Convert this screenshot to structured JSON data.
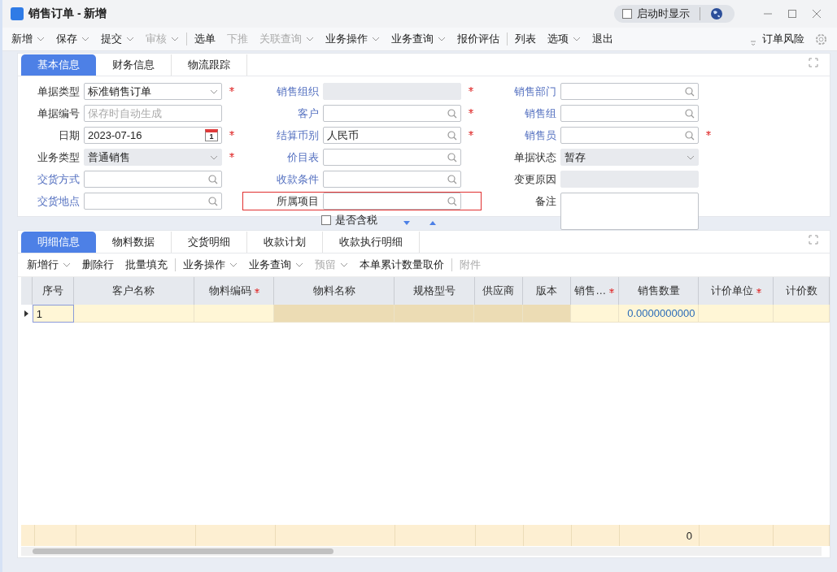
{
  "window": {
    "title": "销售订单 - 新增",
    "startup": {
      "label": "启动时显示",
      "checked": false
    }
  },
  "toolbar": {
    "items": [
      {
        "kind": "button",
        "label": "新增",
        "dropdown": true,
        "disabled": false
      },
      {
        "kind": "button",
        "label": "保存",
        "dropdown": true,
        "disabled": false
      },
      {
        "kind": "button",
        "label": "提交",
        "dropdown": true,
        "disabled": false
      },
      {
        "kind": "button",
        "label": "审核",
        "dropdown": true,
        "disabled": true
      },
      {
        "kind": "separator"
      },
      {
        "kind": "button",
        "label": "选单",
        "dropdown": false,
        "disabled": false
      },
      {
        "kind": "button",
        "label": "下推",
        "dropdown": false,
        "disabled": true
      },
      {
        "kind": "button",
        "label": "关联查询",
        "dropdown": true,
        "disabled": true
      },
      {
        "kind": "button",
        "label": "业务操作",
        "dropdown": true,
        "disabled": false
      },
      {
        "kind": "button",
        "label": "业务查询",
        "dropdown": true,
        "disabled": false
      },
      {
        "kind": "button",
        "label": "报价评估",
        "dropdown": false,
        "disabled": false
      },
      {
        "kind": "separator"
      },
      {
        "kind": "button",
        "label": "列表",
        "dropdown": false,
        "disabled": false
      },
      {
        "kind": "button",
        "label": "选项",
        "dropdown": true,
        "disabled": false
      },
      {
        "kind": "button",
        "label": "退出",
        "dropdown": false,
        "disabled": false
      }
    ],
    "right_label": "订单风险"
  },
  "header_tabs": [
    {
      "label": "基本信息",
      "selected": true
    },
    {
      "label": "财务信息",
      "selected": false
    },
    {
      "label": "物流跟踪",
      "selected": false
    }
  ],
  "form": {
    "columns": [
      {
        "fields": [
          {
            "kind": "select",
            "label": "单据类型",
            "value": "标准销售订单",
            "link": false,
            "required": true,
            "disabled": false,
            "highlighted": false
          },
          {
            "kind": "text",
            "label": "单据编号",
            "placeholder": "保存时自动生成",
            "link": false,
            "required": false,
            "disabled": false,
            "highlighted": false
          },
          {
            "kind": "date",
            "label": "日期",
            "value": "2023-07-16",
            "calendar_day": "1",
            "link": false,
            "required": true,
            "disabled": false,
            "highlighted": false
          },
          {
            "kind": "select",
            "label": "业务类型",
            "value": "普通销售",
            "link": false,
            "required": true,
            "disabled": true,
            "highlighted": false
          },
          {
            "kind": "lookup",
            "label": "交货方式",
            "link": true,
            "required": false,
            "disabled": false,
            "highlighted": false
          },
          {
            "kind": "lookup",
            "label": "交货地点",
            "link": true,
            "required": false,
            "disabled": false,
            "highlighted": false
          }
        ]
      },
      {
        "fields": [
          {
            "kind": "text",
            "label": "销售组织",
            "link": true,
            "required": true,
            "disabled": true,
            "highlighted": false
          },
          {
            "kind": "lookup",
            "label": "客户",
            "link": true,
            "required": true,
            "disabled": false,
            "highlighted": false
          },
          {
            "kind": "lookup",
            "label": "结算币别",
            "value": "人民币",
            "link": true,
            "required": true,
            "disabled": false,
            "highlighted": false
          },
          {
            "kind": "lookup",
            "label": "价目表",
            "link": true,
            "required": false,
            "disabled": false,
            "highlighted": false
          },
          {
            "kind": "lookup",
            "label": "收款条件",
            "link": true,
            "required": false,
            "disabled": false,
            "highlighted": false
          },
          {
            "kind": "lookup",
            "label": "所属项目",
            "link": false,
            "required": false,
            "disabled": false,
            "highlighted": true
          },
          {
            "kind": "checkbox",
            "label": "是否含税",
            "checked": false
          }
        ]
      },
      {
        "fields": [
          {
            "kind": "lookup",
            "label": "销售部门",
            "link": true,
            "required": false,
            "disabled": false,
            "highlighted": false
          },
          {
            "kind": "lookup",
            "label": "销售组",
            "link": true,
            "required": false,
            "disabled": false,
            "highlighted": false
          },
          {
            "kind": "lookup",
            "label": "销售员",
            "link": true,
            "required": true,
            "disabled": false,
            "highlighted": false
          },
          {
            "kind": "select",
            "label": "单据状态",
            "value": "暂存",
            "link": false,
            "required": false,
            "disabled": true,
            "highlighted": false
          },
          {
            "kind": "text",
            "label": "变更原因",
            "link": false,
            "required": false,
            "disabled": true,
            "highlighted": false
          },
          {
            "kind": "textarea",
            "label": "备注",
            "link": false,
            "required": false,
            "disabled": false,
            "highlighted": false
          }
        ]
      }
    ]
  },
  "detail_tabs": [
    {
      "label": "明细信息",
      "selected": true
    },
    {
      "label": "物料数据",
      "selected": false
    },
    {
      "label": "交货明细",
      "selected": false
    },
    {
      "label": "收款计划",
      "selected": false
    },
    {
      "label": "收款执行明细",
      "selected": false
    }
  ],
  "detail_toolbar": [
    {
      "kind": "button",
      "label": "新增行",
      "dropdown": true,
      "disabled": false
    },
    {
      "kind": "button",
      "label": "删除行",
      "dropdown": false,
      "disabled": false
    },
    {
      "kind": "button",
      "label": "批量填充",
      "dropdown": false,
      "disabled": false
    },
    {
      "kind": "separator"
    },
    {
      "kind": "button",
      "label": "业务操作",
      "dropdown": true,
      "disabled": false
    },
    {
      "kind": "button",
      "label": "业务查询",
      "dropdown": true,
      "disabled": false
    },
    {
      "kind": "button",
      "label": "预留",
      "dropdown": true,
      "disabled": true
    },
    {
      "kind": "button",
      "label": "本单累计数量取价",
      "dropdown": false,
      "disabled": false
    },
    {
      "kind": "separator"
    },
    {
      "kind": "button",
      "label": "附件",
      "dropdown": false,
      "disabled": true
    }
  ],
  "table": {
    "columns": [
      {
        "kind": "seq",
        "label": "序号",
        "required": false,
        "locked": false
      },
      {
        "kind": "text",
        "label": "客户名称",
        "required": false,
        "locked": false
      },
      {
        "kind": "text",
        "label": "物料编码",
        "required": true,
        "locked": false
      },
      {
        "kind": "text",
        "label": "物料名称",
        "required": false,
        "locked": true
      },
      {
        "kind": "text",
        "label": "规格型号",
        "required": false,
        "locked": true
      },
      {
        "kind": "text",
        "label": "供应商",
        "required": false,
        "locked": true
      },
      {
        "kind": "text",
        "label": "版本",
        "required": false,
        "locked": true
      },
      {
        "kind": "text",
        "label": "销售…",
        "required": true,
        "locked": false
      },
      {
        "kind": "quantity",
        "label": "销售数量",
        "required": false,
        "locked": false
      },
      {
        "kind": "text",
        "label": "计价单位",
        "required": true,
        "locked": false
      },
      {
        "kind": "text",
        "label": "计价数",
        "required": false,
        "locked": false
      }
    ],
    "rows": [
      {
        "seq": "1",
        "quantity": "0.0000000000",
        "selected": true
      }
    ],
    "summary": "0"
  }
}
